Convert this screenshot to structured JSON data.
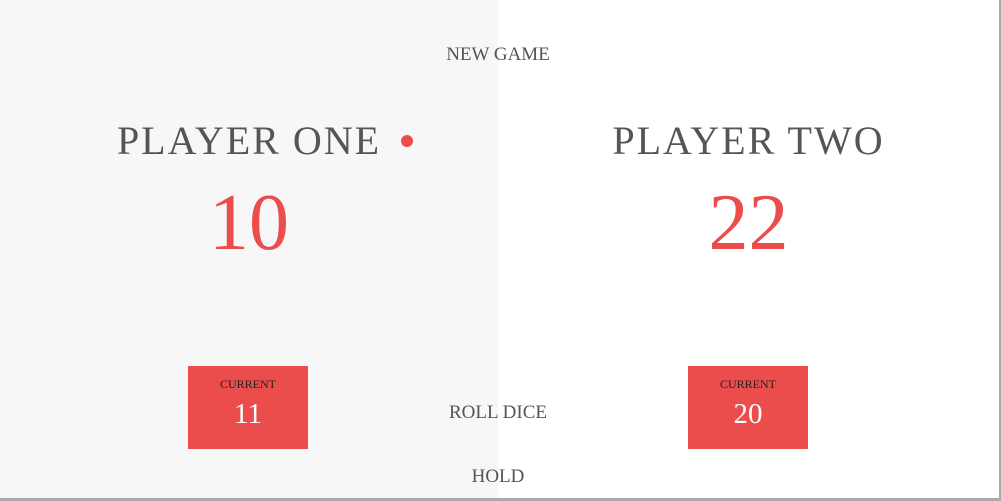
{
  "controls": {
    "new_game": "NEW GAME",
    "roll_dice": "ROLL DICE",
    "hold": "HOLD"
  },
  "players": [
    {
      "name": "PLAYER ONE",
      "score": "10",
      "current_label": "CURRENT",
      "current_score": "11",
      "active": true
    },
    {
      "name": "PLAYER TWO",
      "score": "22",
      "current_label": "CURRENT",
      "current_score": "20",
      "active": false
    }
  ],
  "colors": {
    "accent": "#eb4d4d",
    "left_panel_bg": "#f7f7f7",
    "right_panel_bg": "#ffffff",
    "text": "#555555"
  }
}
